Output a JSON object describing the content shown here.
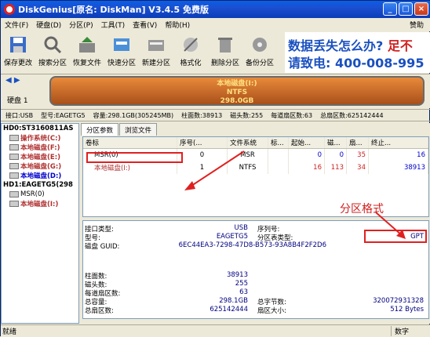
{
  "window": {
    "title": "DiskGenius[原名: DiskMan] V3.4.5 免费版"
  },
  "menu": {
    "items": [
      "文件(F)",
      "硬盘(D)",
      "分区(P)",
      "工具(T)",
      "查看(V)",
      "帮助(H)"
    ],
    "help_right": "赞助"
  },
  "toolbar": {
    "items": [
      {
        "label": "保存更改",
        "icon": "save-icon"
      },
      {
        "label": "搜索分区",
        "icon": "search-icon"
      },
      {
        "label": "恢复文件",
        "icon": "recover-icon"
      },
      {
        "label": "快速分区",
        "icon": "quick-partition-icon"
      },
      {
        "label": "新建分区",
        "icon": "new-partition-icon"
      },
      {
        "label": "格式化",
        "icon": "format-icon"
      },
      {
        "label": "删除分区",
        "icon": "delete-icon"
      },
      {
        "label": "备份分区",
        "icon": "backup-icon"
      }
    ]
  },
  "ad": {
    "line1_a": "数据丢失怎么办?",
    "line1_b": "足不",
    "line2": "请致电: 400-008-995"
  },
  "disk_map": {
    "disk_label": "硬盘 1",
    "part_name": "本地磁盘(I:)",
    "part_fs": "NTFS",
    "part_size": "298.0GB"
  },
  "disk_info": {
    "text": [
      "接口:USB",
      "型号:EAGETG5",
      "容量:298.1GB(305245MB)",
      "柱面数:38913",
      "磁头数:255",
      "每道扇区数:63",
      "总扇区数:625142444"
    ]
  },
  "tree": {
    "nodes": [
      "HD0:ST3160811AS",
      "操作系统(C:)",
      "本地磁盘(F:)",
      "本地磁盘(E:)",
      "本地磁盘(G:)",
      "本地磁盘(D:)",
      "HD1:EAGETG5(298",
      "MSR(0)",
      "本地磁盘(I:)"
    ]
  },
  "tabs": [
    "分区参数",
    "浏览文件"
  ],
  "partition_table": {
    "columns": [
      "卷标",
      "序号(...",
      "文件系统",
      "标...",
      "起始...",
      "磁...",
      "扇...",
      "终止..."
    ],
    "rows": [
      [
        "MSR(0)",
        "0",
        "MSR",
        "",
        "0",
        "0",
        "35",
        "16"
      ],
      [
        "本地磁盘(I:)",
        "1",
        "NTFS",
        "",
        "16",
        "113",
        "34",
        "38913"
      ]
    ]
  },
  "annotation": "分区格式",
  "details": {
    "iface_label": "接口类型:",
    "iface_val": "USB",
    "serial_label": "序列号:",
    "model_label": "型号:",
    "model_val": "EAGETG5",
    "pt_label": "分区表类型:",
    "pt_val": "GPT",
    "guid_label": "磁盘 GUID:",
    "guid_val": "6EC44EA3-7298-47D8-B573-93A8B4F2F2D6",
    "cyl_label": "柱面数:",
    "cyl_val": "38913",
    "heads_label": "磁头数:",
    "heads_val": "255",
    "spt_label": "每道扇区数:",
    "spt_val": "63",
    "cap_label": "总容量:",
    "cap_val": "298.1GB",
    "bytes_label": "总字节数:",
    "bytes_val": "320072931328",
    "sectors_label": "总扇区数:",
    "sectors_val": "625142444",
    "secsize_label": "扇区大小:",
    "secsize_val": "512 Bytes"
  },
  "status": {
    "left": "就绪",
    "right": "数字"
  }
}
